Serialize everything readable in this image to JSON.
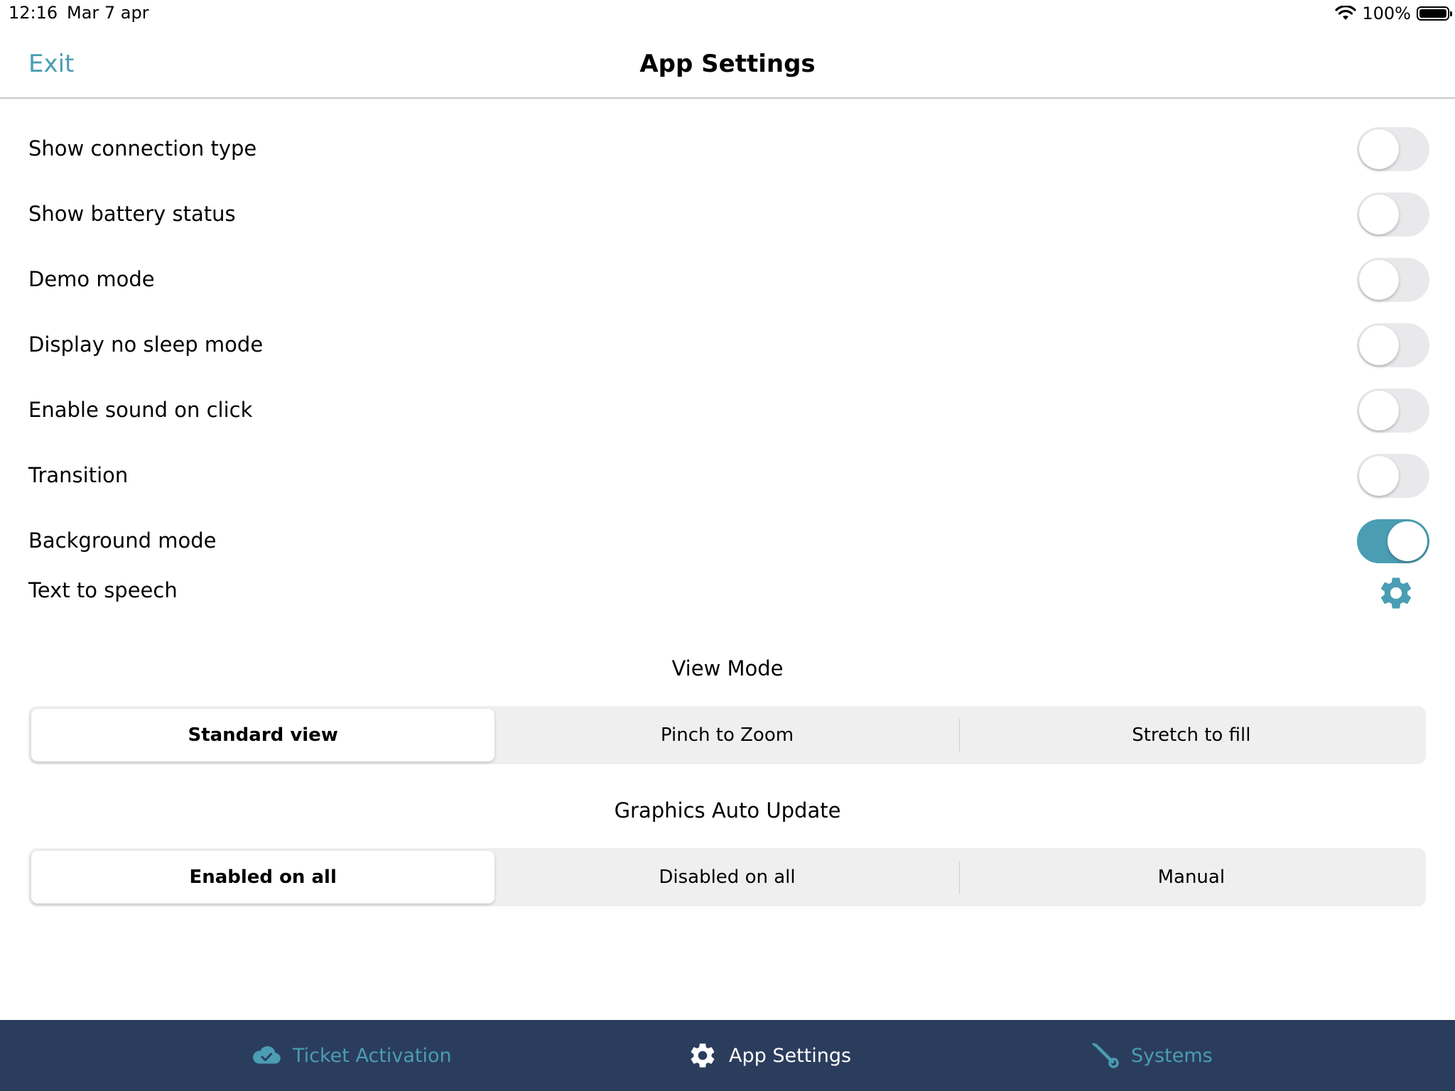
{
  "status_bar": {
    "time": "12:16",
    "date": "Mar 7 apr",
    "battery": "100%"
  },
  "nav": {
    "exit_label": "Exit",
    "title": "App Settings"
  },
  "settings": {
    "rows": [
      {
        "label": "Show connection type",
        "on": false
      },
      {
        "label": "Show battery status",
        "on": false
      },
      {
        "label": "Demo mode",
        "on": false
      },
      {
        "label": "Display no sleep mode",
        "on": false
      },
      {
        "label": "Enable sound on click",
        "on": false
      },
      {
        "label": "Transition",
        "on": false
      },
      {
        "label": "Background mode",
        "on": true
      }
    ],
    "tts_label": "Text to speech",
    "tts_icon": "gear-icon"
  },
  "view_mode": {
    "title": "View Mode",
    "options": [
      "Standard view",
      "Pinch to Zoom",
      "Stretch to fill"
    ],
    "selected": "Standard view"
  },
  "graphics_update": {
    "title": "Graphics Auto Update",
    "options": [
      "Enabled on all",
      "Disabled on all",
      "Manual"
    ],
    "selected": "Enabled on all"
  },
  "tab_bar": {
    "tabs": [
      {
        "label": "Ticket Activation",
        "icon": "cloud-check-icon",
        "active": false
      },
      {
        "label": "App Settings",
        "icon": "gear-icon",
        "active": true
      },
      {
        "label": "Systems",
        "icon": "wrench-icon",
        "active": false
      }
    ]
  },
  "colors": {
    "accent": "#4a9db3",
    "tab_bar_bg": "#2b3d5d",
    "toggle_off": "#e9e9eb",
    "segment_bg": "#efefef"
  }
}
